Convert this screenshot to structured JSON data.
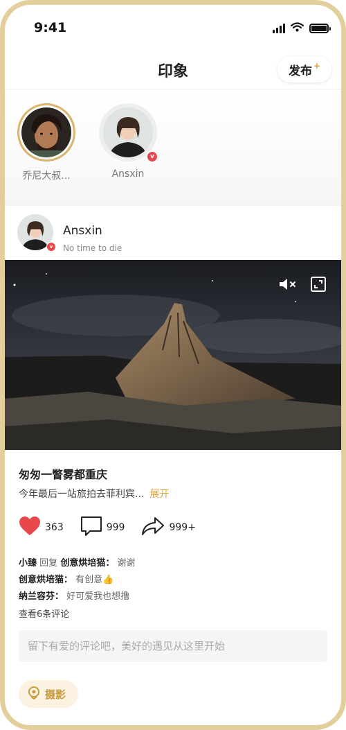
{
  "status_bar": {
    "time": "9:41"
  },
  "nav": {
    "title": "印象",
    "publish_label": "发布",
    "publish_plus": "+"
  },
  "stories": [
    {
      "name": "乔尼大叔...",
      "active": true
    },
    {
      "name": "Ansxin",
      "active": false,
      "badge": "v"
    }
  ],
  "post": {
    "author": "Ansxin",
    "subtitle": "No time to die",
    "author_badge": "v",
    "title": "匆匆一瞥雾都重庆",
    "description": "今年最后一站旅拍去菲利宾...",
    "expand_label": "展开",
    "media": {
      "mute_icon": "speaker-mute-icon",
      "fullscreen_icon": "fullscreen-icon"
    },
    "actions": {
      "likes": "363",
      "comments": "999",
      "shares": "999+"
    },
    "comments": [
      {
        "user": "小臻",
        "reply_word": "回复",
        "reply_to": "创意烘培猫：",
        "text": "谢谢"
      },
      {
        "user": "创意烘培猫：",
        "text": "有创意",
        "emoji": "👍"
      },
      {
        "user": "纳兰容芬：",
        "text": "好可爱我也想撸"
      }
    ],
    "view_all": "查看6条评论",
    "input_placeholder": "留下有爱的评论吧，美好的遇见从这里开始",
    "tag": "摄影"
  },
  "colors": {
    "accent": "#d9a441",
    "like": "#e8474b",
    "frame": "#e2cf9c"
  }
}
